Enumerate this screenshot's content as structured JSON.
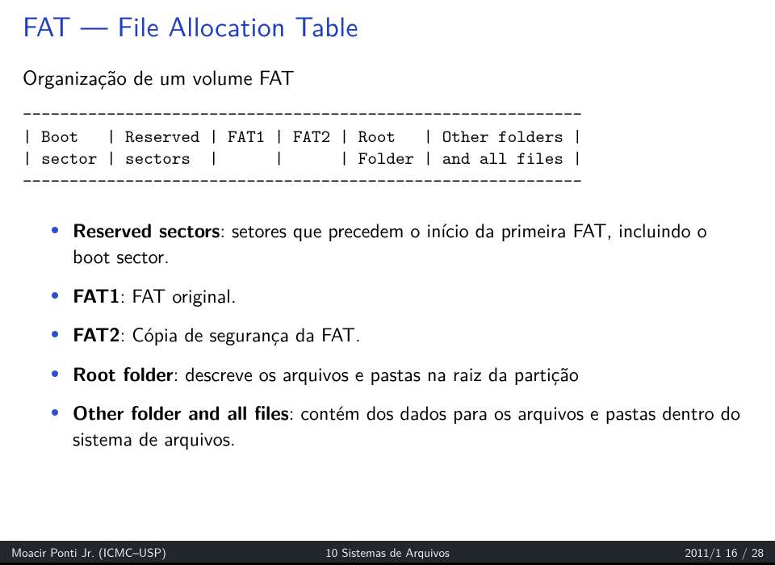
{
  "title": "FAT — File Allocation Table",
  "subtitle": "Organização de um volume FAT",
  "diagram": {
    "rule": "------------------------------------------------------------",
    "row1": "| Boot   | Reserved | FAT1 | FAT2 | Root   | Other folders |",
    "row2": "| sector | sectors  |      |      | Folder | and all files |",
    "rule2": "------------------------------------------------------------"
  },
  "bullets": [
    {
      "bold": "Reserved sectors",
      "rest": ": setores que precedem o início da primeira FAT, incluindo o boot sector."
    },
    {
      "bold": "FAT1",
      "rest": ": FAT original."
    },
    {
      "bold": "FAT2",
      "rest": ": Cópia de segurança da FAT."
    },
    {
      "bold": "Root folder",
      "rest": ": descreve os arquivos e pastas na raiz da partição"
    },
    {
      "bold": "Other folder and all files",
      "rest": ": contém dos dados para os arquivos e pastas dentro do sistema de arquivos."
    }
  ],
  "footer": {
    "left": "Moacir Ponti Jr. (ICMC–USP)",
    "center": "10 Sistemas de Arquivos",
    "right": "2011/1   16 / 28"
  }
}
